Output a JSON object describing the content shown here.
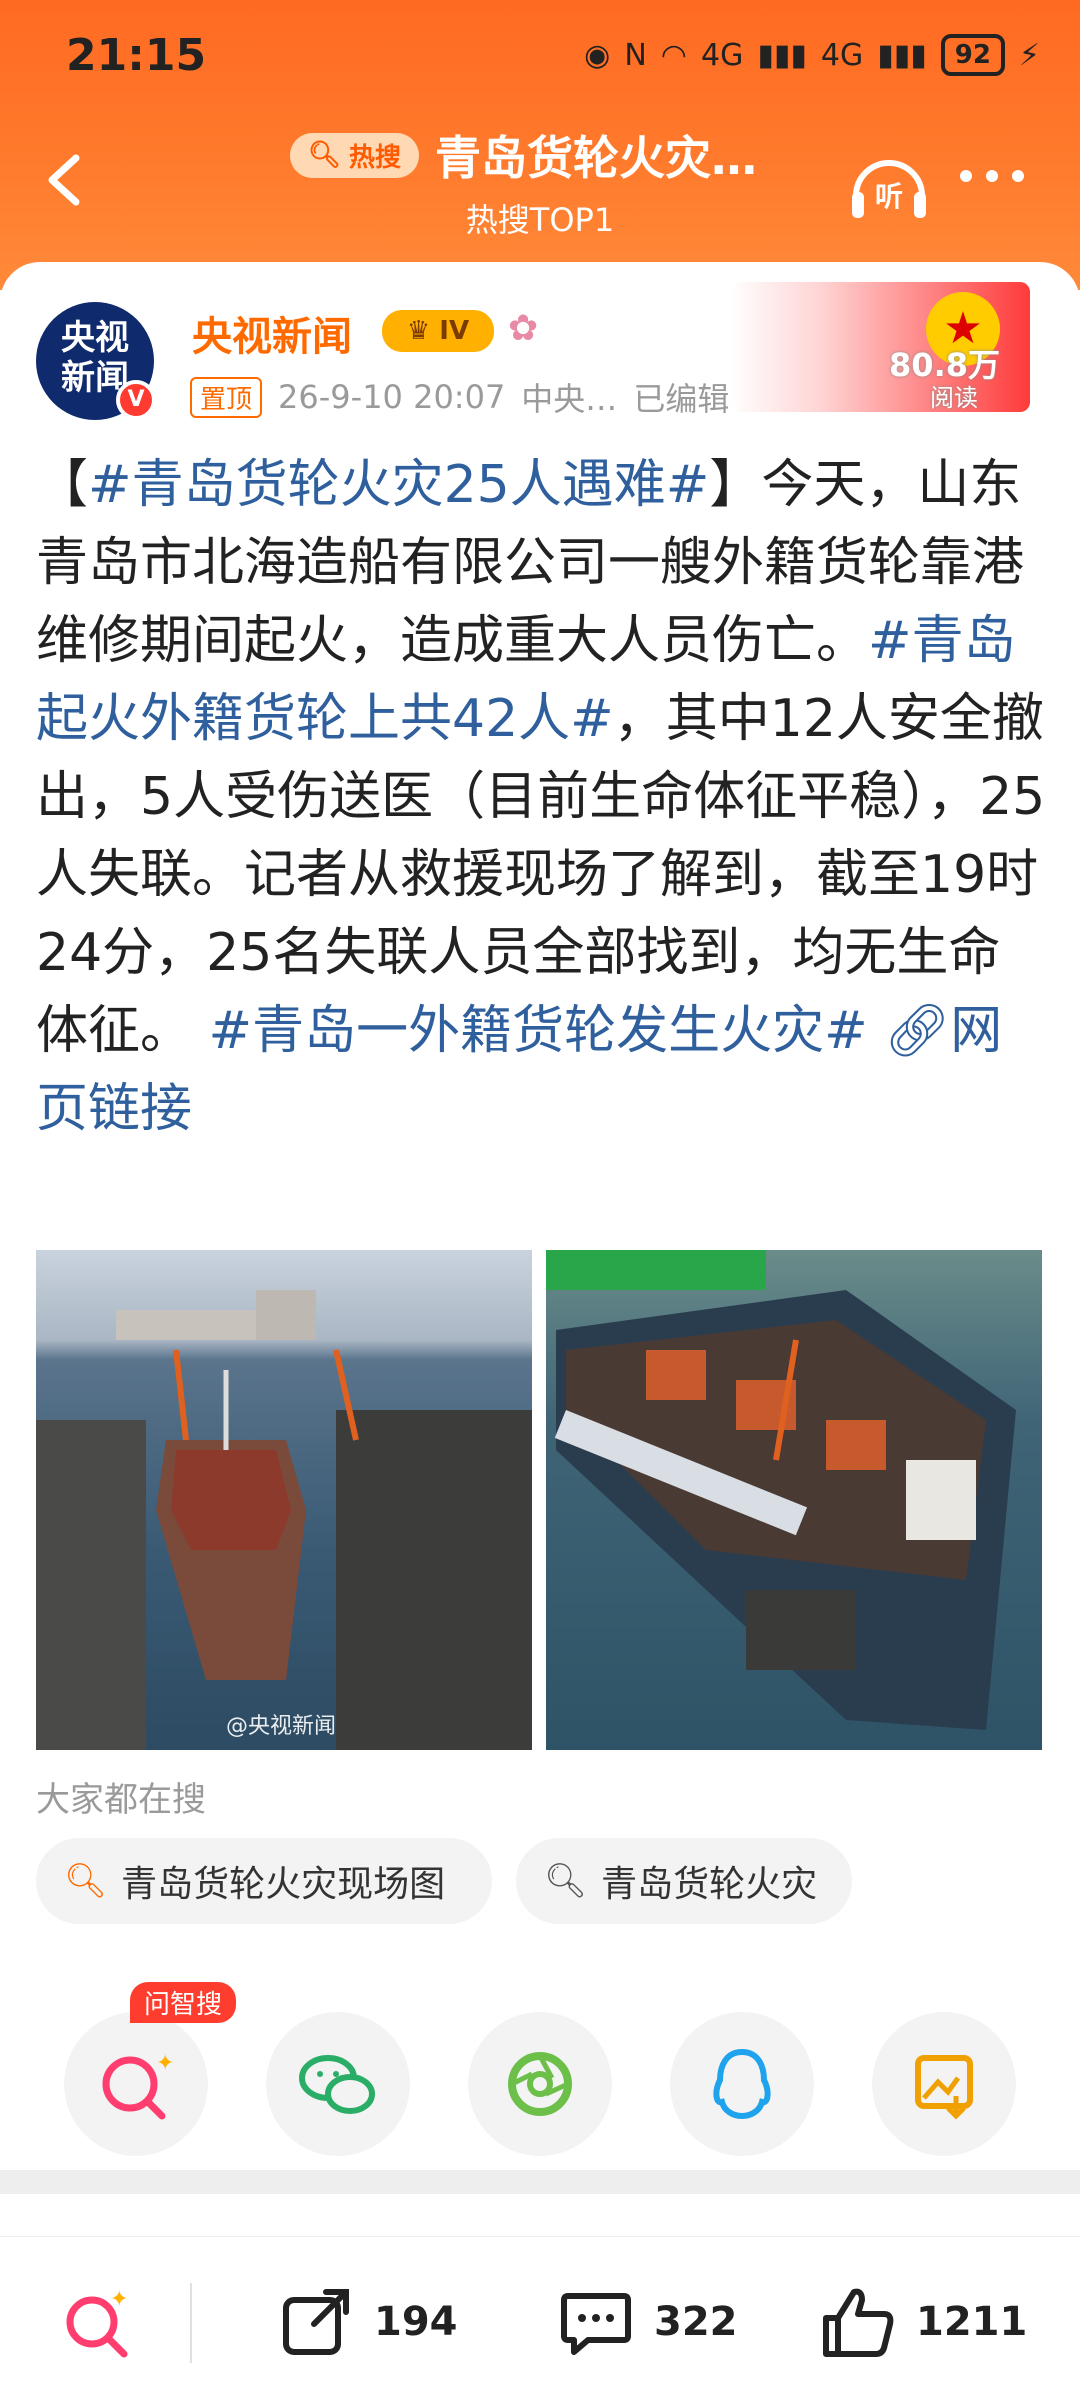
{
  "status_bar": {
    "time": "21:15",
    "network": "4G",
    "battery": "92"
  },
  "header": {
    "hot_tag": "热搜",
    "title": "青岛货轮火灾…",
    "subtitle": "热搜TOP1",
    "listen_label": "听"
  },
  "post": {
    "author": "央视新闻",
    "avatar_text": "央视\n新闻",
    "rank_label": "IV",
    "pin_label": "置顶",
    "date": "26-9-10 20:07",
    "source": "中央…",
    "edited": "已编辑",
    "views_count": "80.8万",
    "views_label": "阅读",
    "content": {
      "p1_open": "【",
      "tag1": "#青岛货轮火灾25人遇难#",
      "p1_close": "】今天，山东青岛市北海造船有限公司一艘外籍货轮靠港维修期间起火，造成重大人员伤亡。",
      "tag2": "#青岛起火外籍货轮上共42人#",
      "p2": "，其中12人安全撤出，5人受伤送医（目前生命体征平稳），25人失联。记者从救援现场了解到，截至19时24分，25名失联人员全部找到，均无生命体征。",
      "tag3": "#青岛一外籍货轮发生火灾#",
      "link": "网页链接"
    },
    "image_watermark": "@央视新闻"
  },
  "also_search": {
    "label": "大家都在搜",
    "chips": [
      "青岛货轮火灾现场图",
      "青岛货轮火灾"
    ]
  },
  "share": {
    "ai_badge": "问智搜",
    "items": [
      "ai-search",
      "wechat",
      "moments",
      "qq",
      "save-image"
    ]
  },
  "bottom_bar": {
    "repost_count": "194",
    "comment_count": "322",
    "like_count": "1211"
  },
  "colors": {
    "header_orange": "#ff6a22",
    "tag_blue": "#2f5f9c",
    "author_orange": "#ff6a00"
  }
}
